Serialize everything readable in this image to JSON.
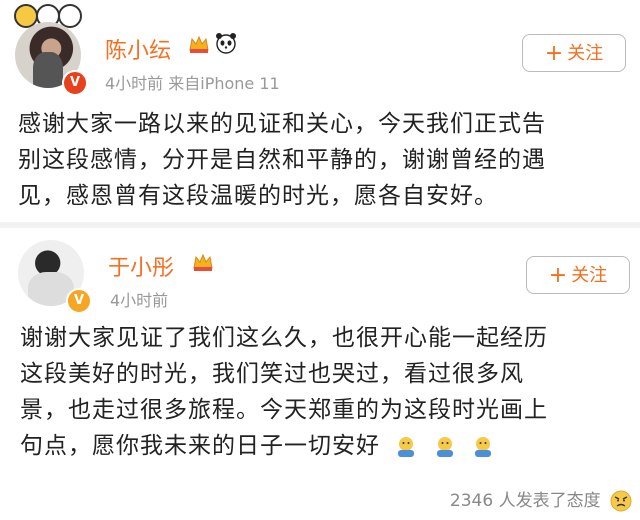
{
  "posts": [
    {
      "author": "陈小纭",
      "meta": "4小时前  来自iPhone 11",
      "follow_label": "关注",
      "content_lines": [
        "感谢大家一路以来的见证和关心，今天我们正式告",
        "别这段感情，分开是自然和平静的，谢谢曾经的遇",
        "见，感恩曾有这段温暖的时光，愿各自安好。"
      ]
    },
    {
      "author": "于小彤",
      "meta": "4小时前",
      "follow_label": "关注",
      "content_lines": [
        "谢谢大家见证了我们这么久，也很开心能一起经历",
        "这段美好的时光，我们笑过也哭过，看过很多风",
        "景，也走过很多旅程。今天郑重的为这段时光画上",
        "句点，愿你我未来的日子一切安好"
      ]
    }
  ],
  "footer": {
    "reactions_text": "2346 人发表了态度"
  },
  "colors": {
    "accent": "#f86e1f",
    "meta": "#999999",
    "badge_red": "#e8411c",
    "badge_gold": "#f5a623"
  }
}
